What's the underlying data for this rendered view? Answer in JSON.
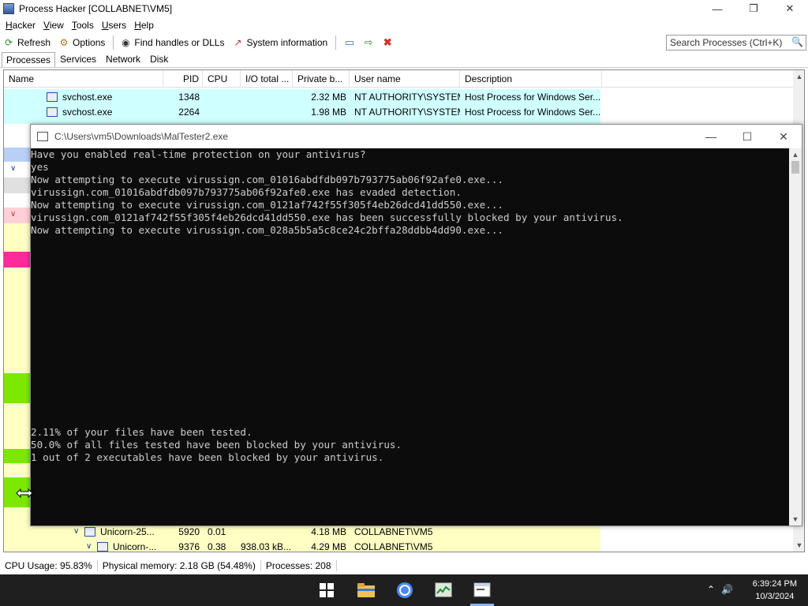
{
  "ph": {
    "title": "Process Hacker [COLLABNET\\VM5]",
    "menu": [
      "Hacker",
      "View",
      "Tools",
      "Users",
      "Help"
    ],
    "toolbar": {
      "refresh": "Refresh",
      "options": "Options",
      "find_handles": "Find handles or DLLs",
      "system_info": "System information"
    },
    "search_placeholder": "Search Processes (Ctrl+K)",
    "tabs": [
      "Processes",
      "Services",
      "Network",
      "Disk"
    ],
    "columns": [
      "Name",
      "PID",
      "CPU",
      "I/O total ...",
      "Private b...",
      "User name",
      "Description"
    ],
    "rows_top": [
      {
        "name": "svchost.exe",
        "pid": "1348",
        "cpu": "",
        "io": "",
        "priv": "2.32 MB",
        "user": "NT AUTHORITY\\SYSTEM",
        "desc": "Host Process for Windows Ser..."
      },
      {
        "name": "svchost.exe",
        "pid": "2264",
        "cpu": "",
        "io": "",
        "priv": "1.98 MB",
        "user": "NT AUTHORITY\\SYSTEM",
        "desc": "Host Process for Windows Ser..."
      }
    ],
    "rows_bottom": [
      {
        "name": "Unicorn-25...",
        "pid": "5920",
        "cpu": "0.01",
        "io": "",
        "priv": "4.18 MB",
        "user": "COLLABNET\\VM5",
        "desc": ""
      },
      {
        "name": "Unicorn-...",
        "pid": "9376",
        "cpu": "0.38",
        "io": "938.03 kB...",
        "priv": "4.29 MB",
        "user": "COLLABNET\\VM5",
        "desc": ""
      }
    ],
    "status": {
      "cpu": "CPU Usage: 95.83%",
      "mem": "Physical memory: 2.18 GB (54.48%)",
      "procs": "Processes: 208"
    }
  },
  "console": {
    "title": "C:\\Users\\vm5\\Downloads\\MalTester2.exe",
    "lines": [
      "Have you enabled real-time protection on your antivirus?",
      "yes",
      "Now attempting to execute virussign.com_01016abdfdb097b793775ab06f92afe0.exe...",
      "virussign.com_01016abdfdb097b793775ab06f92afe0.exe has evaded detection.",
      "Now attempting to execute virussign.com_0121af742f55f305f4eb26dcd41dd550.exe...",
      "virussign.com_0121af742f55f305f4eb26dcd41dd550.exe has been successfully blocked by your antivirus.",
      "Now attempting to execute virussign.com_028a5b5a5c8ce24c2bffa28ddbb4dd90.exe..."
    ],
    "summary": [
      "2.11% of your files have been tested.",
      "50.0% of all files tested have been blocked by your antivirus.",
      "1 out of 2 executables have been blocked by your antivirus."
    ]
  },
  "taskbar": {
    "time": "6:39:24 PM",
    "date": "10/3/2024",
    "icons": [
      "windows-start-icon",
      "file-explorer-icon",
      "chrome-icon",
      "process-hacker-icon",
      "console-app-icon"
    ]
  },
  "colors": {
    "service_row": "#d0ffff",
    "own_process_row": "#ffffc4",
    "console_bg": "#0c0c0c",
    "console_text": "#cccccc",
    "taskbar": "#1f1f1f"
  }
}
